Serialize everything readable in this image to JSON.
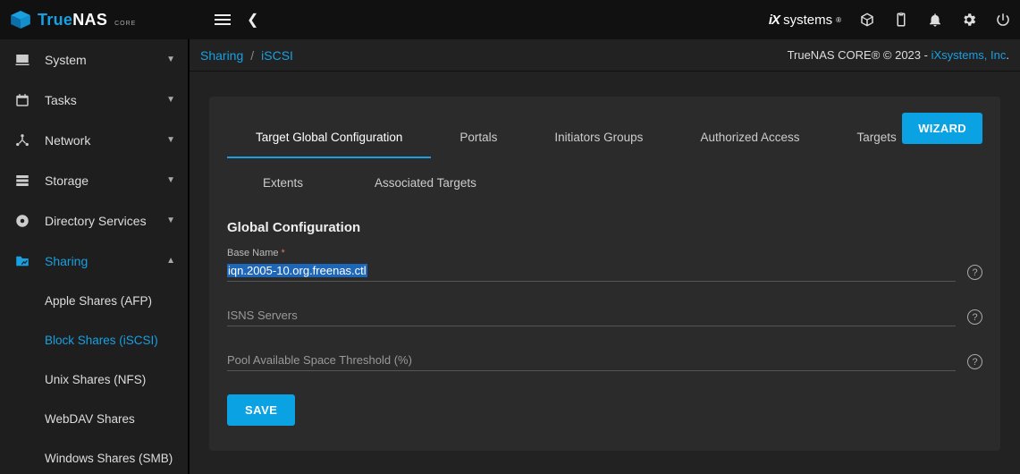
{
  "brand": {
    "name_a": "True",
    "name_b": "NAS",
    "sub": "CORE"
  },
  "ix": {
    "a": "iX",
    "b": "systems"
  },
  "breadcrumb": {
    "root": "Sharing",
    "leaf": "iSCSI"
  },
  "copyright": {
    "text": "TrueNAS CORE® © 2023 - ",
    "link": "iXsystems, Inc"
  },
  "buttons": {
    "wizard": "WIZARD",
    "save": "SAVE"
  },
  "sidebar": [
    {
      "icon": "desktop",
      "label": "System",
      "expandable": true
    },
    {
      "icon": "calendar",
      "label": "Tasks",
      "expandable": true
    },
    {
      "icon": "network",
      "label": "Network",
      "expandable": true
    },
    {
      "icon": "storage",
      "label": "Storage",
      "expandable": true
    },
    {
      "icon": "circle",
      "label": "Directory Services",
      "expandable": true
    },
    {
      "icon": "folder",
      "label": "Sharing",
      "expandable": true,
      "open": true,
      "active": true,
      "children": [
        {
          "label": "Apple Shares (AFP)"
        },
        {
          "label": "Block Shares (iSCSI)",
          "active": true
        },
        {
          "label": "Unix Shares (NFS)"
        },
        {
          "label": "WebDAV Shares"
        },
        {
          "label": "Windows Shares (SMB)"
        }
      ]
    }
  ],
  "tabs_row1": [
    {
      "label": "Target Global Configuration",
      "active": true
    },
    {
      "label": "Portals"
    },
    {
      "label": "Initiators Groups"
    },
    {
      "label": "Authorized Access"
    },
    {
      "label": "Targets"
    }
  ],
  "tabs_row2": [
    {
      "label": "Extents"
    },
    {
      "label": "Associated Targets"
    }
  ],
  "section_title": "Global Configuration",
  "fields": {
    "base_name": {
      "label": "Base Name",
      "required": true,
      "value": "iqn.2005-10.org.freenas.ctl",
      "highlighted": true
    },
    "isns": {
      "label": "ISNS Servers",
      "value": ""
    },
    "pool_thresh": {
      "label": "Pool Available Space Threshold (%)",
      "value": ""
    }
  }
}
